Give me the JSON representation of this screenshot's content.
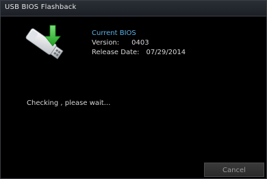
{
  "window": {
    "title": "USB BIOS Flashback"
  },
  "icon": {
    "name": "usb-flash-drive-download-icon"
  },
  "bios": {
    "heading": "Current BIOS",
    "version_label": "Version:",
    "version_value": "0403",
    "release_label": "Release Date:",
    "release_value": "07/29/2014"
  },
  "status": {
    "message": "Checking , please wait..."
  },
  "actions": {
    "cancel_label": "Cancel"
  },
  "colors": {
    "accent_heading": "#5db0e6",
    "arrow_green": "#34c834",
    "background": "#000000"
  }
}
